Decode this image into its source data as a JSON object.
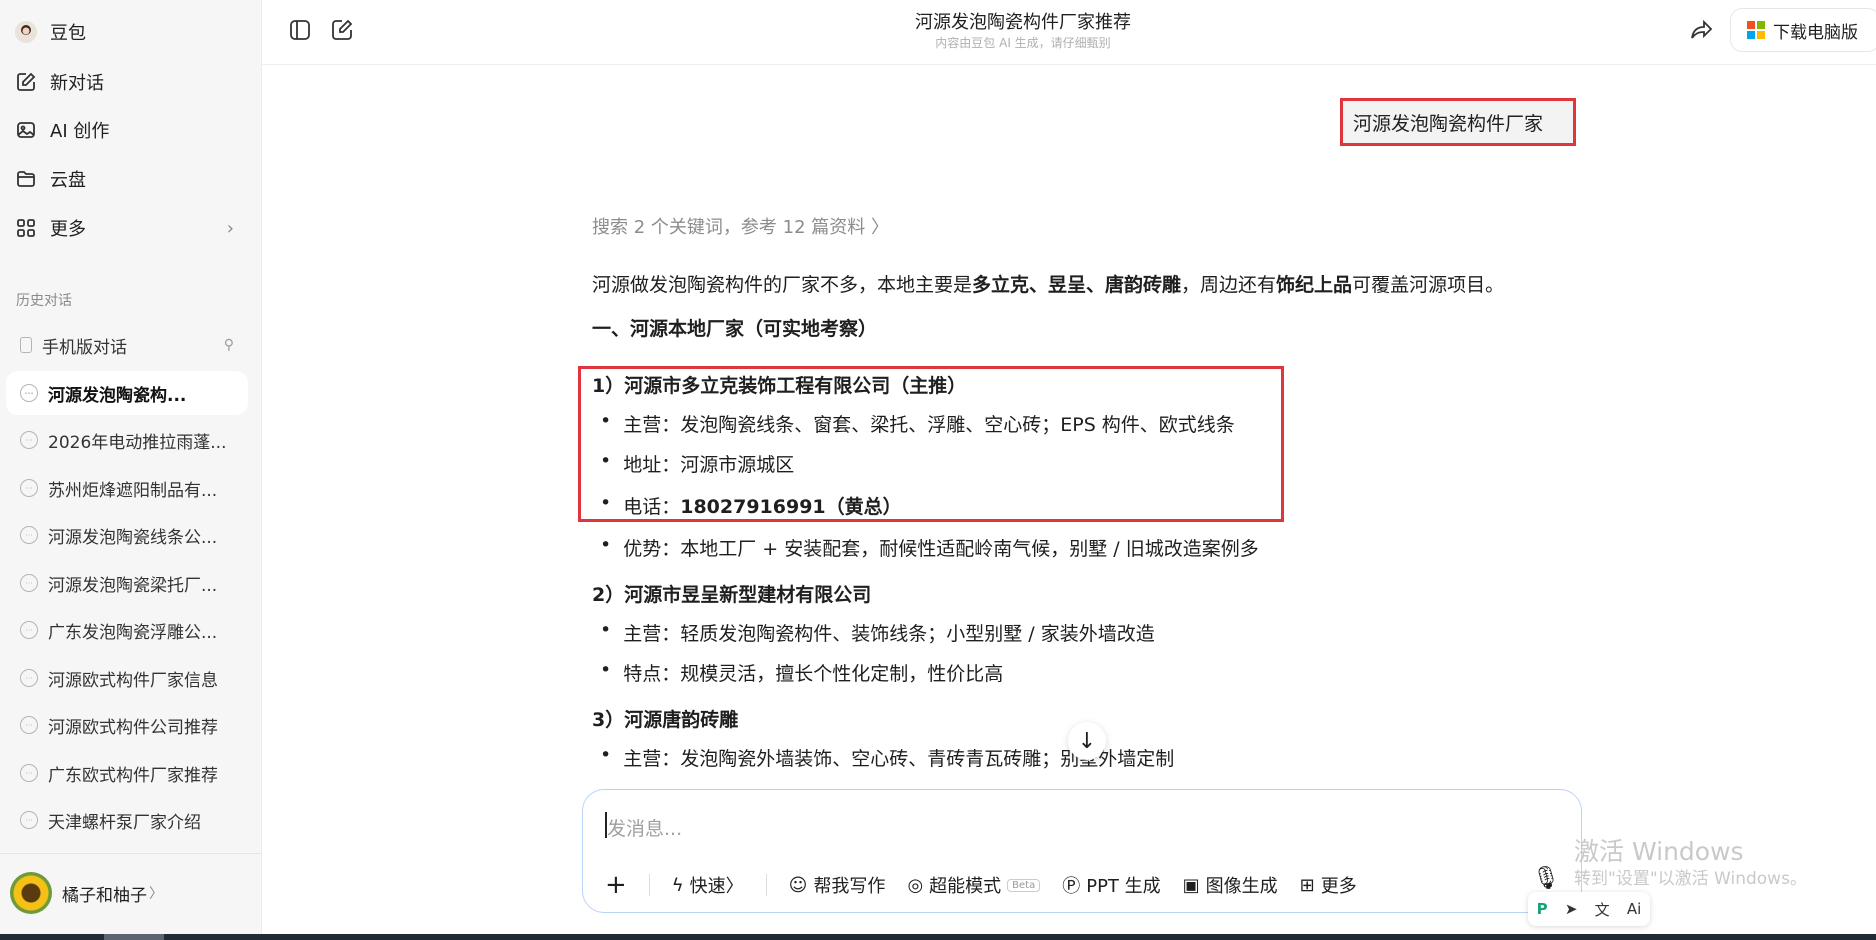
{
  "sidebar": {
    "app_name": "豆包",
    "nav": [
      {
        "label": "新对话",
        "icon": "edit-icon"
      },
      {
        "label": "AI 创作",
        "icon": "image-icon"
      },
      {
        "label": "云盘",
        "icon": "folder-icon"
      },
      {
        "label": "更多",
        "icon": "grid-icon"
      }
    ],
    "history_title": "历史对话",
    "history": [
      "手机版对话",
      "河源发泡陶瓷构...",
      "2026年电动推拉雨蓬...",
      "苏州炬烽遮阳制品有...",
      "河源发泡陶瓷线条公...",
      "河源发泡陶瓷梁托厂...",
      "广东发泡陶瓷浮雕公...",
      "河源欧式构件厂家信息",
      "河源欧式构件公司推荐",
      "广东欧式构件厂家推荐",
      "天津螺杆泵厂家介绍"
    ],
    "user_name": "橘子和柚子",
    "user_chevron": "〉"
  },
  "header": {
    "title": "河源发泡陶瓷构件厂家推荐",
    "subtitle": "内容由豆包 AI 生成，请仔细甄别",
    "download_label": "下载电脑版"
  },
  "chat": {
    "user_message": "河源发泡陶瓷构件厂家",
    "search_info": "搜索 2 个关键词，参考 12 篇资料 〉",
    "intro_a": "河源做发泡陶瓷构件的厂家不多，本地主要是",
    "intro_b": "多立克、昱呈、唐韵砖雕",
    "intro_c": "，周边还有",
    "intro_d": "饰纪上品",
    "intro_e": "可覆盖河源项目。",
    "section1": "一、河源本地厂家（可实地考察）",
    "company1": "1）河源市多立克装饰工程有限公司（主推）",
    "c1_main_k": "主营：",
    "c1_main_v": "发泡陶瓷线条、窗套、梁托、浮雕、空心砖；EPS 构件、欧式线条",
    "c1_addr_k": "地址：",
    "c1_addr_v": "河源市源城区",
    "c1_tel_k": "电话：",
    "c1_tel_v": "18027916991（黄总）",
    "c1_adv_k": "优势：",
    "c1_adv_v": "本地工厂 + 安装配套，耐候性适配岭南气候，别墅 / 旧城改造案例多",
    "company2": "2）河源市昱呈新型建材有限公司",
    "c2_main_k": "主营：",
    "c2_main_v": "轻质发泡陶瓷构件、装饰线条；小型别墅 / 家装外墙改造",
    "c2_feat_k": "特点：",
    "c2_feat_v": "规模灵活，擅长个性化定制，性价比高",
    "company3": "3）河源唐韵砖雕",
    "c3_main_k": "主营：",
    "c3_main_v": "发泡陶瓷外墙装饰、空心砖、青砖青瓦砖雕；别墅外墙定制"
  },
  "composer": {
    "placeholder": "发消息...",
    "tools": [
      "快速〉",
      "帮我写作",
      "超能模式",
      "PPT 生成",
      "图像生成",
      "更多"
    ],
    "beta": "Beta"
  },
  "watermark": {
    "line1": "激活 Windows",
    "line2": "转到\"设置\"以激活 Windows。"
  },
  "colors": {
    "highlight_border": "#e0353c",
    "composer_border": "#b9d3f7"
  }
}
